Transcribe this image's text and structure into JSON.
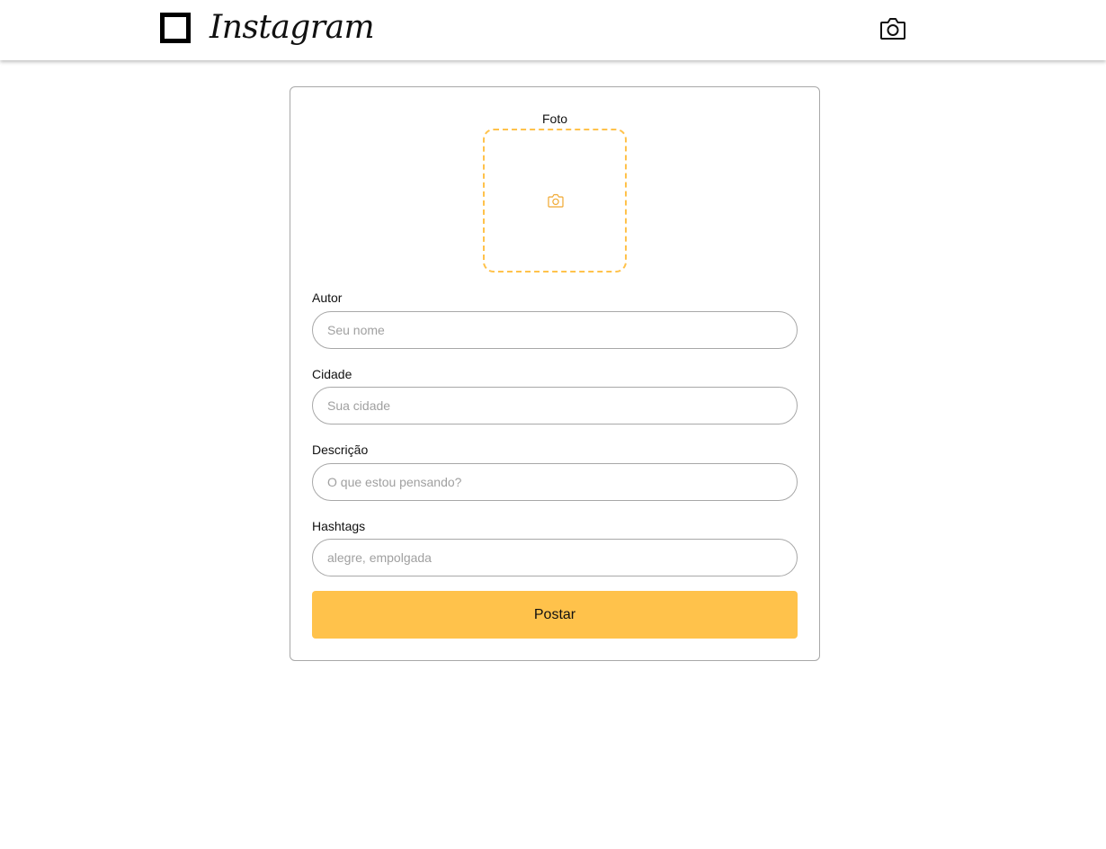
{
  "header": {
    "brand": "Instagram",
    "icons": {
      "logo": "square-logo-icon",
      "action": "camera-icon"
    }
  },
  "form": {
    "photo": {
      "label": "Foto",
      "icon": "camera-icon"
    },
    "fields": [
      {
        "label": "Autor",
        "placeholder": "Seu nome",
        "value": ""
      },
      {
        "label": "Cidade",
        "placeholder": "Sua cidade",
        "value": ""
      },
      {
        "label": "Descrição",
        "placeholder": "O que estou pensando?",
        "value": ""
      },
      {
        "label": "Hashtags",
        "placeholder": "alegre, empolgada",
        "value": ""
      }
    ],
    "submit_label": "Postar"
  },
  "colors": {
    "accent": "#ffc24b",
    "border": "#a8a8a8",
    "placeholder": "#a0a0a0",
    "text": "#111111"
  }
}
